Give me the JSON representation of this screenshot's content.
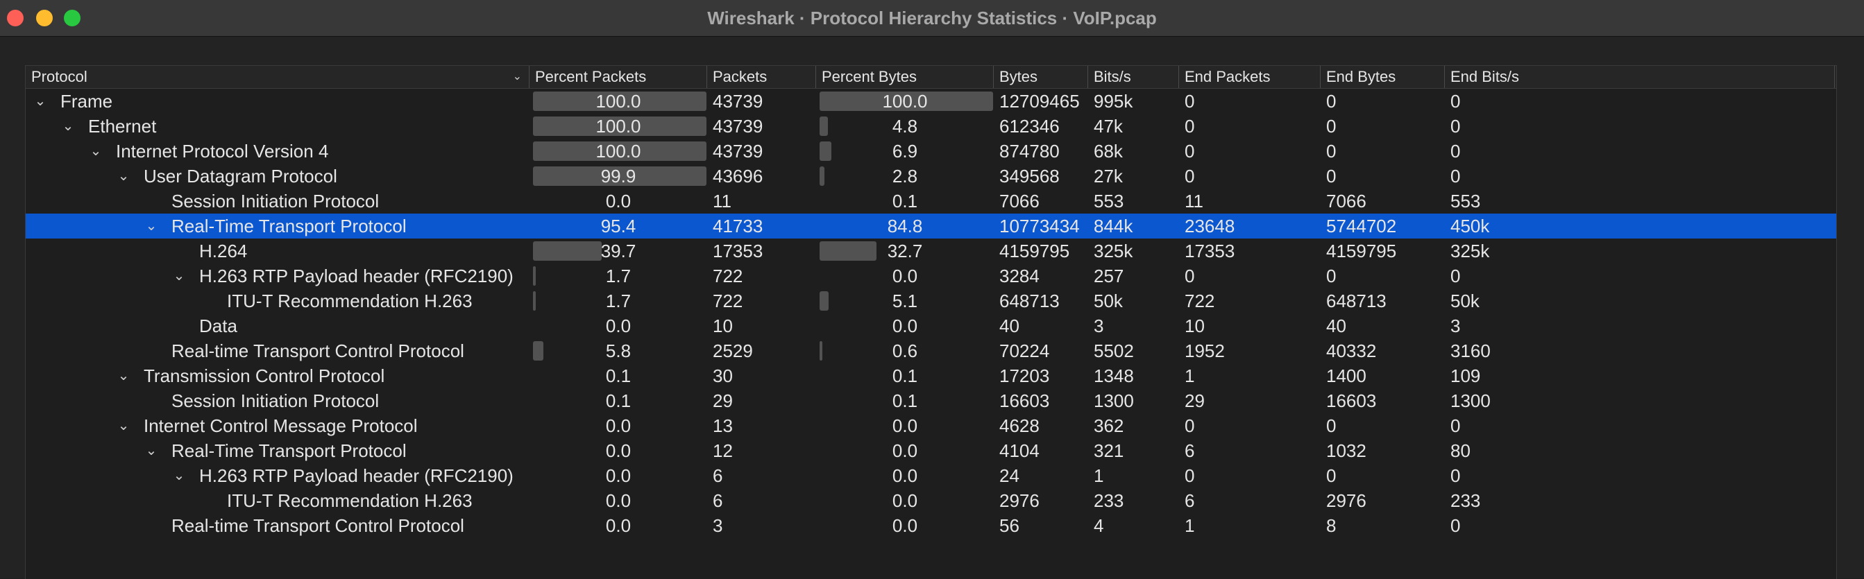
{
  "window": {
    "title": "Wireshark · Protocol Hierarchy Statistics · VoIP.pcap"
  },
  "columns": [
    "Protocol",
    "Percent Packets",
    "Packets",
    "Percent Bytes",
    "Bytes",
    "Bits/s",
    "End Packets",
    "End Bytes",
    "End Bits/s"
  ],
  "rows": [
    {
      "protocol": "Frame",
      "depth": 0,
      "expanded": true,
      "pct_packets": "100.0",
      "packets": "43739",
      "pct_bytes": "100.0",
      "bytes": "12709465",
      "bits": "995k",
      "end_packets": "0",
      "end_bytes": "0",
      "end_bits": "0"
    },
    {
      "protocol": "Ethernet",
      "depth": 1,
      "expanded": true,
      "pct_packets": "100.0",
      "packets": "43739",
      "pct_bytes": "4.8",
      "bytes": "612346",
      "bits": "47k",
      "end_packets": "0",
      "end_bytes": "0",
      "end_bits": "0"
    },
    {
      "protocol": "Internet Protocol Version 4",
      "depth": 2,
      "expanded": true,
      "pct_packets": "100.0",
      "packets": "43739",
      "pct_bytes": "6.9",
      "bytes": "874780",
      "bits": "68k",
      "end_packets": "0",
      "end_bytes": "0",
      "end_bits": "0"
    },
    {
      "protocol": "User Datagram Protocol",
      "depth": 3,
      "expanded": true,
      "pct_packets": "99.9",
      "packets": "43696",
      "pct_bytes": "2.8",
      "bytes": "349568",
      "bits": "27k",
      "end_packets": "0",
      "end_bytes": "0",
      "end_bits": "0"
    },
    {
      "protocol": "Session Initiation Protocol",
      "depth": 4,
      "expanded": null,
      "pct_packets": "0.0",
      "packets": "11",
      "pct_bytes": "0.1",
      "bytes": "7066",
      "bits": "553",
      "end_packets": "11",
      "end_bytes": "7066",
      "end_bits": "553"
    },
    {
      "protocol": "Real-Time Transport Protocol",
      "depth": 4,
      "expanded": true,
      "selected": true,
      "pct_packets": "95.4",
      "packets": "41733",
      "pct_bytes": "84.8",
      "bytes": "10773434",
      "bits": "844k",
      "end_packets": "23648",
      "end_bytes": "5744702",
      "end_bits": "450k"
    },
    {
      "protocol": "H.264",
      "depth": 5,
      "expanded": null,
      "pct_packets": "39.7",
      "packets": "17353",
      "pct_bytes": "32.7",
      "bytes": "4159795",
      "bits": "325k",
      "end_packets": "17353",
      "end_bytes": "4159795",
      "end_bits": "325k"
    },
    {
      "protocol": "H.263 RTP Payload header (RFC2190)",
      "depth": 5,
      "expanded": true,
      "pct_packets": "1.7",
      "packets": "722",
      "pct_bytes": "0.0",
      "bytes": "3284",
      "bits": "257",
      "end_packets": "0",
      "end_bytes": "0",
      "end_bits": "0"
    },
    {
      "protocol": "ITU-T Recommendation H.263",
      "depth": 6,
      "expanded": null,
      "pct_packets": "1.7",
      "packets": "722",
      "pct_bytes": "5.1",
      "bytes": "648713",
      "bits": "50k",
      "end_packets": "722",
      "end_bytes": "648713",
      "end_bits": "50k"
    },
    {
      "protocol": "Data",
      "depth": 5,
      "expanded": null,
      "pct_packets": "0.0",
      "packets": "10",
      "pct_bytes": "0.0",
      "bytes": "40",
      "bits": "3",
      "end_packets": "10",
      "end_bytes": "40",
      "end_bits": "3"
    },
    {
      "protocol": "Real-time Transport Control Protocol",
      "depth": 4,
      "expanded": null,
      "pct_packets": "5.8",
      "packets": "2529",
      "pct_bytes": "0.6",
      "bytes": "70224",
      "bits": "5502",
      "end_packets": "1952",
      "end_bytes": "40332",
      "end_bits": "3160"
    },
    {
      "protocol": "Transmission Control Protocol",
      "depth": 3,
      "expanded": true,
      "pct_packets": "0.1",
      "packets": "30",
      "pct_bytes": "0.1",
      "bytes": "17203",
      "bits": "1348",
      "end_packets": "1",
      "end_bytes": "1400",
      "end_bits": "109"
    },
    {
      "protocol": "Session Initiation Protocol",
      "depth": 4,
      "expanded": null,
      "pct_packets": "0.1",
      "packets": "29",
      "pct_bytes": "0.1",
      "bytes": "16603",
      "bits": "1300",
      "end_packets": "29",
      "end_bytes": "16603",
      "end_bits": "1300"
    },
    {
      "protocol": "Internet Control Message Protocol",
      "depth": 3,
      "expanded": true,
      "pct_packets": "0.0",
      "packets": "13",
      "pct_bytes": "0.0",
      "bytes": "4628",
      "bits": "362",
      "end_packets": "0",
      "end_bytes": "0",
      "end_bits": "0"
    },
    {
      "protocol": "Real-Time Transport Protocol",
      "depth": 4,
      "expanded": true,
      "pct_packets": "0.0",
      "packets": "12",
      "pct_bytes": "0.0",
      "bytes": "4104",
      "bits": "321",
      "end_packets": "6",
      "end_bytes": "1032",
      "end_bits": "80"
    },
    {
      "protocol": "H.263 RTP Payload header (RFC2190)",
      "depth": 5,
      "expanded": true,
      "pct_packets": "0.0",
      "packets": "6",
      "pct_bytes": "0.0",
      "bytes": "24",
      "bits": "1",
      "end_packets": "0",
      "end_bytes": "0",
      "end_bits": "0"
    },
    {
      "protocol": "ITU-T Recommendation H.263",
      "depth": 6,
      "expanded": null,
      "pct_packets": "0.0",
      "packets": "6",
      "pct_bytes": "0.0",
      "bytes": "2976",
      "bits": "233",
      "end_packets": "6",
      "end_bytes": "2976",
      "end_bits": "233"
    },
    {
      "protocol": "Real-time Transport Control Protocol",
      "depth": 4,
      "expanded": null,
      "pct_packets": "0.0",
      "packets": "3",
      "pct_bytes": "0.0",
      "bytes": "56",
      "bits": "4",
      "end_packets": "1",
      "end_bytes": "8",
      "end_bits": "0"
    }
  ]
}
